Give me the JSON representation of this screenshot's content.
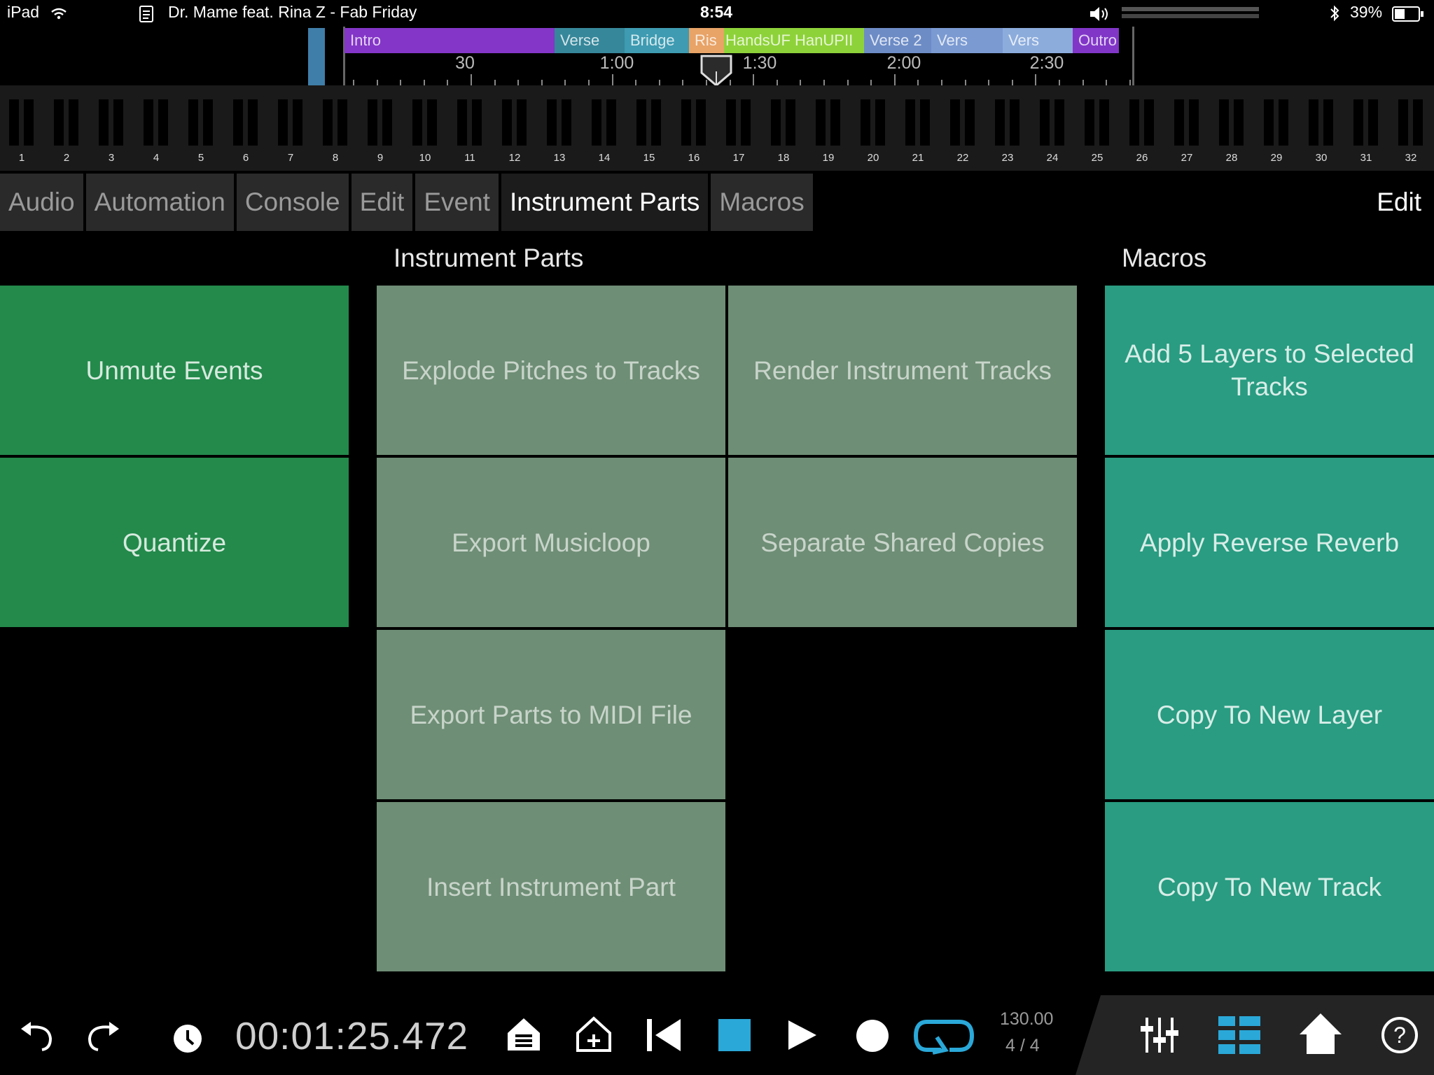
{
  "status_bar": {
    "device": "iPad",
    "song": "Dr. Mame feat. Rina Z - Fab Friday",
    "time": "8:54",
    "battery": "39%"
  },
  "timeline": {
    "segments": [
      {
        "label": "Intro",
        "color": "#8436c8"
      },
      {
        "label": "Verse",
        "color": "#36879a"
      },
      {
        "label": "Bridge",
        "color": "#3e9bb1"
      },
      {
        "label": "Ris",
        "color": "#e8a367"
      },
      {
        "label": "HandsUF HanUPII",
        "color": "#8ed23a"
      },
      {
        "label": "Verse 2",
        "color": "#6d8cc6"
      },
      {
        "label": "Vers",
        "color": "#7b9ad2"
      },
      {
        "label": "Vers",
        "color": "#8cacdc"
      },
      {
        "label": "Outro",
        "color": "#8136c8"
      }
    ],
    "ticks": [
      "30",
      "1:00",
      "1:30",
      "2:00",
      "2:30"
    ]
  },
  "piano": {
    "numbers": [
      "1",
      "2",
      "3",
      "4",
      "5",
      "6",
      "7",
      "8",
      "9",
      "10",
      "11",
      "12",
      "13",
      "14",
      "15",
      "16",
      "17",
      "18",
      "19",
      "20",
      "21",
      "22",
      "23",
      "24",
      "25",
      "26",
      "27",
      "28",
      "29",
      "30",
      "31",
      "32"
    ]
  },
  "tabs": {
    "items": [
      "Audio",
      "Automation",
      "Console",
      "Edit",
      "Event",
      "Instrument Parts",
      "Macros"
    ],
    "active": "Instrument Parts",
    "edit_label": "Edit"
  },
  "sections": {
    "instrument_parts": "Instrument Parts",
    "macros": "Macros"
  },
  "buttons": {
    "unmute_events": "Unmute Events",
    "quantize": "Quantize",
    "explode_pitches": "Explode Pitches to Tracks",
    "render_instrument": "Render Instrument Tracks",
    "export_musicloop": "Export Musicloop",
    "separate_shared": "Separate Shared Copies",
    "export_midi": "Export Parts to MIDI File",
    "insert_instrument": "Insert Instrument Part",
    "add_layers": "Add 5 Layers to Selected Tracks",
    "reverse_reverb": "Apply Reverse Reverb",
    "copy_layer": "Copy To New Layer",
    "copy_track": "Copy To New Track"
  },
  "transport": {
    "time": "00:01:25.472",
    "tempo": "130.00",
    "signature": "4 / 4",
    "accent": "#2aa8d8"
  },
  "icons": [
    "undo-icon",
    "redo-icon",
    "clock-icon",
    "marker-list-icon",
    "add-marker-icon",
    "rewind-to-start-icon",
    "stop-icon",
    "play-icon",
    "record-icon",
    "loop-icon",
    "mixer-icon",
    "grid-icon",
    "home-icon",
    "help-icon"
  ]
}
